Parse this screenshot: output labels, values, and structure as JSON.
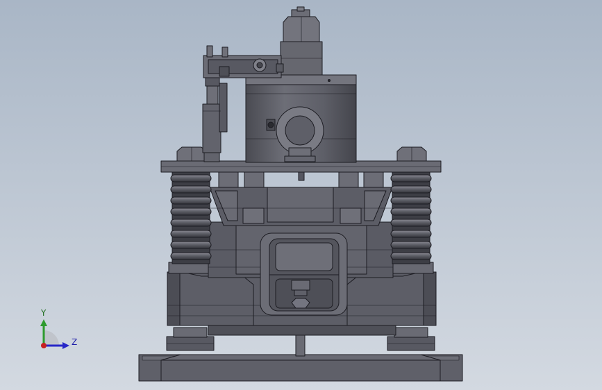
{
  "viewport": {
    "background_top": "#a9b6c6",
    "background_bottom": "#d3d9e1"
  },
  "model": {
    "body_color": "#5f6069",
    "body_dark": "#484950",
    "body_light": "#7a7b84",
    "edge_color": "#1c1c22"
  },
  "triad": {
    "y_label": "Y",
    "z_label": "Z",
    "y_color": "#2e9b2e",
    "z_color": "#2727c8",
    "x_color": "#c62020",
    "origin_color": "#c62020"
  }
}
